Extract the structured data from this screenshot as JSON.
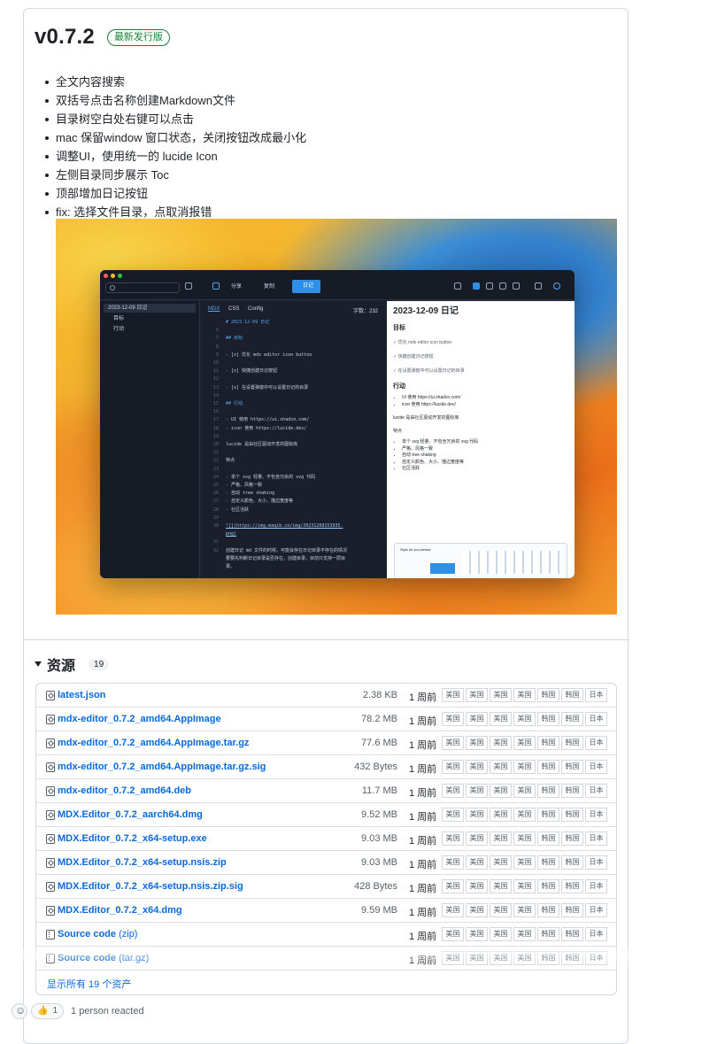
{
  "release": {
    "version": "v0.7.2",
    "badge": "最新发行版",
    "notes": [
      "全文内容搜索",
      "双括号点击名称创建Markdown文件",
      "目录树空白处右键可以点击",
      "mac 保留window 窗口状态，关闭按钮改成最小化",
      "调整UI，使用统一的 lucide Icon",
      "左侧目录同步展示 Toc",
      "顶部增加日记按钮",
      "fix: 选择文件目录，点取消报错"
    ]
  },
  "screenshot": {
    "toolbar": {
      "share": "分享",
      "copy": "复制",
      "journal": "日记"
    },
    "sidebar": {
      "date": "2023-12-09 日记",
      "items": [
        "目标",
        "行动"
      ]
    },
    "editor": {
      "tabs": [
        "MDX",
        "CSS",
        "Config"
      ],
      "word_count": "字数：232",
      "lines": [
        {
          "n": "",
          "t": "# 2023-12-09 日记",
          "c": "hd"
        },
        {
          "n": "6",
          "t": "",
          "c": ""
        },
        {
          "n": "7",
          "t": "## 目标",
          "c": "hd"
        },
        {
          "n": "8",
          "t": "",
          "c": ""
        },
        {
          "n": "9",
          "t": "- [x] 优化 mdx editor icon button",
          "c": ""
        },
        {
          "n": "10",
          "t": "",
          "c": ""
        },
        {
          "n": "11",
          "t": "- [x] 快捷创建日记按钮",
          "c": ""
        },
        {
          "n": "12",
          "t": "",
          "c": ""
        },
        {
          "n": "13",
          "t": "- [x] 在设置弹窗中可以设置日记的目录",
          "c": ""
        },
        {
          "n": "14",
          "t": "",
          "c": ""
        },
        {
          "n": "15",
          "t": "## 行动",
          "c": "hd"
        },
        {
          "n": "16",
          "t": "",
          "c": ""
        },
        {
          "n": "17",
          "t": "- UI 使用 https://ui.shadcn.com/",
          "c": ""
        },
        {
          "n": "18",
          "t": "- icon 使用 https://lucide.dev/",
          "c": ""
        },
        {
          "n": "19",
          "t": "",
          "c": ""
        },
        {
          "n": "20",
          "t": "lucide 是由社区驱动开发的图标库",
          "c": ""
        },
        {
          "n": "21",
          "t": "",
          "c": ""
        },
        {
          "n": "22",
          "t": "特点",
          "c": ""
        },
        {
          "n": "23",
          "t": "",
          "c": ""
        },
        {
          "n": "24",
          "t": "- 单个 svg 轻量、不包含冗余的 svg 代码",
          "c": ""
        },
        {
          "n": "25",
          "t": "- 严格、风格一致",
          "c": ""
        },
        {
          "n": "26",
          "t": "- 自动 tree shaking",
          "c": ""
        },
        {
          "n": "27",
          "t": "- 自定义颜色、大小、描边宽度等",
          "c": ""
        },
        {
          "n": "28",
          "t": "- 社区活跃",
          "c": ""
        },
        {
          "n": "29",
          "t": "",
          "c": ""
        },
        {
          "n": "30",
          "t": "![](https://img.maqib.cn/img/20231208153935.",
          "c": "lk"
        },
        {
          "n": "",
          "t": "png)",
          "c": "lk"
        },
        {
          "n": "31",
          "t": "",
          "c": ""
        },
        {
          "n": "32",
          "t": "创建日记 md 文件的时候，可能会存在日记目录不存在的情况",
          "c": ""
        },
        {
          "n": "",
          "t": "要要先判断日记目录是否存在，创建目录，目前只支持一层目",
          "c": ""
        },
        {
          "n": "",
          "t": "录。",
          "c": ""
        }
      ]
    },
    "preview": {
      "title": "2023-12-09 日记",
      "h_goal": "目标",
      "tasks": [
        "优化 mdx editor icon button",
        "快捷创建日记按钮",
        "在设置弹窗中可以设置日记的目录"
      ],
      "h_action": "行动",
      "links": [
        "UI 使用 https://ui.shadcn.com/",
        "icon 使用 https://lucide.dev/"
      ],
      "lucide": "lucide 是由社区驱动开发的图标库",
      "features_label": "特点",
      "features": [
        "单个 svg 轻量、不包含冗余的 svg 代码",
        "严格、风格一致",
        "自动 tree shaking",
        "自定义颜色、大小、描边宽度等",
        "社区活跃"
      ],
      "card_title": "Style as you please"
    }
  },
  "assets": {
    "title": "资源",
    "count": "19",
    "mirror_labels": [
      "美国",
      "美国",
      "美国",
      "美国",
      "韩国",
      "韩国",
      "日本"
    ],
    "items": [
      {
        "name": "latest.json",
        "suffix": "",
        "size": "2.38 KB",
        "time": "1 周前",
        "icon": "package-icon"
      },
      {
        "name": "mdx-editor_0.7.2_amd64.AppImage",
        "suffix": "",
        "size": "78.2 MB",
        "time": "1 周前",
        "icon": "package-icon"
      },
      {
        "name": "mdx-editor_0.7.2_amd64.AppImage.tar.gz",
        "suffix": "",
        "size": "77.6 MB",
        "time": "1 周前",
        "icon": "package-icon"
      },
      {
        "name": "mdx-editor_0.7.2_amd64.AppImage.tar.gz.sig",
        "suffix": "",
        "size": "432 Bytes",
        "time": "1 周前",
        "icon": "package-icon"
      },
      {
        "name": "mdx-editor_0.7.2_amd64.deb",
        "suffix": "",
        "size": "11.7 MB",
        "time": "1 周前",
        "icon": "package-icon"
      },
      {
        "name": "MDX.Editor_0.7.2_aarch64.dmg",
        "suffix": "",
        "size": "9.52 MB",
        "time": "1 周前",
        "icon": "package-icon"
      },
      {
        "name": "MDX.Editor_0.7.2_x64-setup.exe",
        "suffix": "",
        "size": "9.03 MB",
        "time": "1 周前",
        "icon": "package-icon"
      },
      {
        "name": "MDX.Editor_0.7.2_x64-setup.nsis.zip",
        "suffix": "",
        "size": "9.03 MB",
        "time": "1 周前",
        "icon": "package-icon"
      },
      {
        "name": "MDX.Editor_0.7.2_x64-setup.nsis.zip.sig",
        "suffix": "",
        "size": "428 Bytes",
        "time": "1 周前",
        "icon": "package-icon"
      },
      {
        "name": "MDX.Editor_0.7.2_x64.dmg",
        "suffix": "",
        "size": "9.59 MB",
        "time": "1 周前",
        "icon": "package-icon"
      },
      {
        "name": "Source code",
        "suffix": " (zip)",
        "size": "",
        "time": "1 周前",
        "icon": "file-zip-icon"
      },
      {
        "name": "Source code",
        "suffix": " (tar.gz)",
        "size": "",
        "time": "1 周前",
        "icon": "file-zip-icon"
      }
    ],
    "show_all": "显示所有 19 个资产"
  },
  "reactions": {
    "thumbs_count": "1",
    "summary": "1 person reacted"
  }
}
